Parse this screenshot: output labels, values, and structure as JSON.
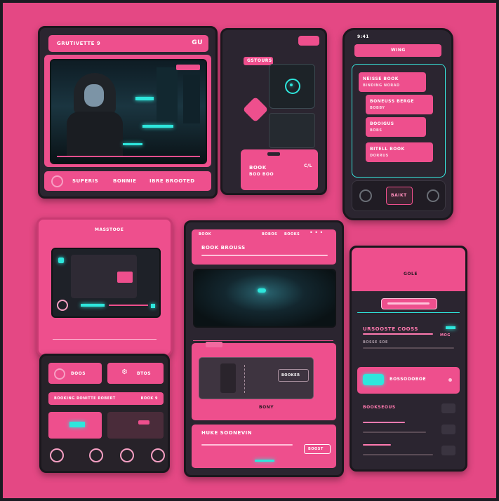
{
  "palette": {
    "canvas": "#e44884",
    "device": "#2b2530",
    "accent_pink": "#ee4f8d",
    "accent_cyan": "#2ee6dc"
  },
  "tablet_game": {
    "title": "GRUTIVETTE 9",
    "logo": "GU",
    "footer_items": [
      "SUPERIS",
      "BONNIE",
      "IBRE BROOTED"
    ]
  },
  "phone_small": {
    "top_label": "GSTOURS",
    "card_title": "BOOK",
    "card_sub": "BOO BOO",
    "card_badge": "C/L"
  },
  "phone_list": {
    "status_left": "9:41",
    "header_label": "WING",
    "items": [
      {
        "title": "NEISSE BOOK",
        "sub": "BINDING NORAD"
      },
      {
        "title": "BONEUSS BERGE",
        "sub": "BOBBY"
      },
      {
        "title": "BOOIGUS",
        "sub": "BOBS"
      },
      {
        "title": "BITELL BOOK",
        "sub": "DORRUS"
      }
    ],
    "bottom_label": "BAIKT"
  },
  "tablet_dashboard": {
    "title": "MASSTOOE",
    "tiles": [
      {
        "label": "BOOS"
      },
      {
        "label": "BTOS"
      }
    ],
    "strip_text": "BOOKING RONITTE ROBERT",
    "strip_value": "BOOK 9"
  },
  "tablet_scene": {
    "header": "BOOK BROUSS",
    "nav_items": [
      "BOOK",
      "BOBOS",
      "BOOKS"
    ],
    "console_label": "BONY",
    "console_value": "BOOKER",
    "section_title": "HUKE SOONEVIN",
    "button_label": "BOOST"
  },
  "phone_tall": {
    "top_label": "GOLE",
    "section_title": "URSOOSTE COOSS",
    "badge": "MOG",
    "row_text": "BOSSE SOE",
    "card_title": "BOSSOOOBOE",
    "list_header": "BOOKSEOUS"
  }
}
